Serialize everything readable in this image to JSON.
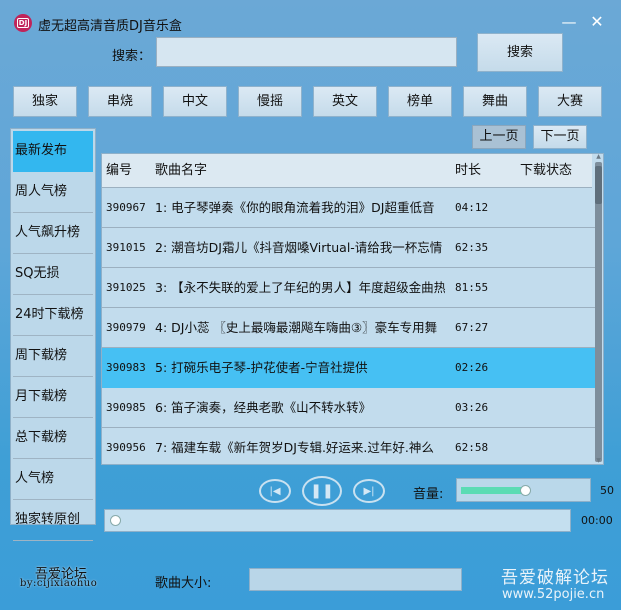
{
  "window": {
    "title": "虚无超高清音质DJ音乐盒",
    "app_icon_text": "DJ",
    "minimize_label": "—",
    "close_label": "✕"
  },
  "search": {
    "label": "搜索：",
    "value": "",
    "placeholder": "",
    "button_label": "搜索"
  },
  "categories": [
    {
      "label": "独家"
    },
    {
      "label": "串烧"
    },
    {
      "label": "中文"
    },
    {
      "label": "慢摇"
    },
    {
      "label": "英文"
    },
    {
      "label": "榜单"
    },
    {
      "label": "舞曲"
    },
    {
      "label": "大赛"
    }
  ],
  "pager": {
    "prev_label": "上一页",
    "next_label": "下一页"
  },
  "sidebar": {
    "items": [
      {
        "label": "最新发布",
        "active": true
      },
      {
        "label": "周人气榜"
      },
      {
        "label": "人气飙升榜"
      },
      {
        "label": "SQ无损"
      },
      {
        "label": "24时下载榜"
      },
      {
        "label": "周下载榜"
      },
      {
        "label": "月下载榜"
      },
      {
        "label": "总下载榜"
      },
      {
        "label": "人气榜"
      },
      {
        "label": "独家转原创"
      }
    ]
  },
  "table": {
    "columns": [
      "编号",
      "歌曲名字",
      "时长",
      "下载状态"
    ],
    "rows": [
      {
        "id": "390967",
        "name": "1: 电子琴弹奏《你的眼角流着我的泪》DJ超重低音",
        "duration": "04:12",
        "status": ""
      },
      {
        "id": "391015",
        "name": "2: 潮音坊DJ霜儿《抖音烟嗓Virtual-请给我一杯忘情",
        "duration": "62:35",
        "status": ""
      },
      {
        "id": "391025",
        "name": "3: 【永不失联的爱上了年纪的男人】年度超级金曲热",
        "duration": "81:55",
        "status": ""
      },
      {
        "id": "390979",
        "name": "4: DJ小蕊  〖史上最嗨最潮飚车嗨曲③〗豪车专用舞",
        "duration": "67:27",
        "status": ""
      },
      {
        "id": "390983",
        "name": "5: 打碗乐电子琴-护花使者-宁音社提供",
        "duration": "02:26",
        "status": "",
        "selected": true
      },
      {
        "id": "390985",
        "name": "6: 笛子演奏，经典老歌《山不转水转》",
        "duration": "03:26",
        "status": ""
      },
      {
        "id": "390956",
        "name": "7: 福建车载《新年贺岁DJ专辑.好运来.过年好.神么",
        "duration": "62:58",
        "status": ""
      }
    ]
  },
  "player": {
    "prev_icon": "skip-previous-icon",
    "pause_icon": "pause-icon",
    "next_icon": "skip-next-icon",
    "volume_label": "音量:",
    "volume": 50,
    "volume_max": 100,
    "progress_percent": 0,
    "time": "00:00"
  },
  "footer": {
    "forum": "吾爱论坛",
    "author": "by:cijixiaohuo",
    "size_label": "歌曲大小:",
    "size_value": "",
    "brand_name": "吾爱破解论坛",
    "brand_url": "www.52pojie.cn"
  },
  "colors": {
    "accent_selected": "#33b7ef",
    "volume_fill": "#5bdcb4",
    "app_icon": "#c0245a"
  }
}
